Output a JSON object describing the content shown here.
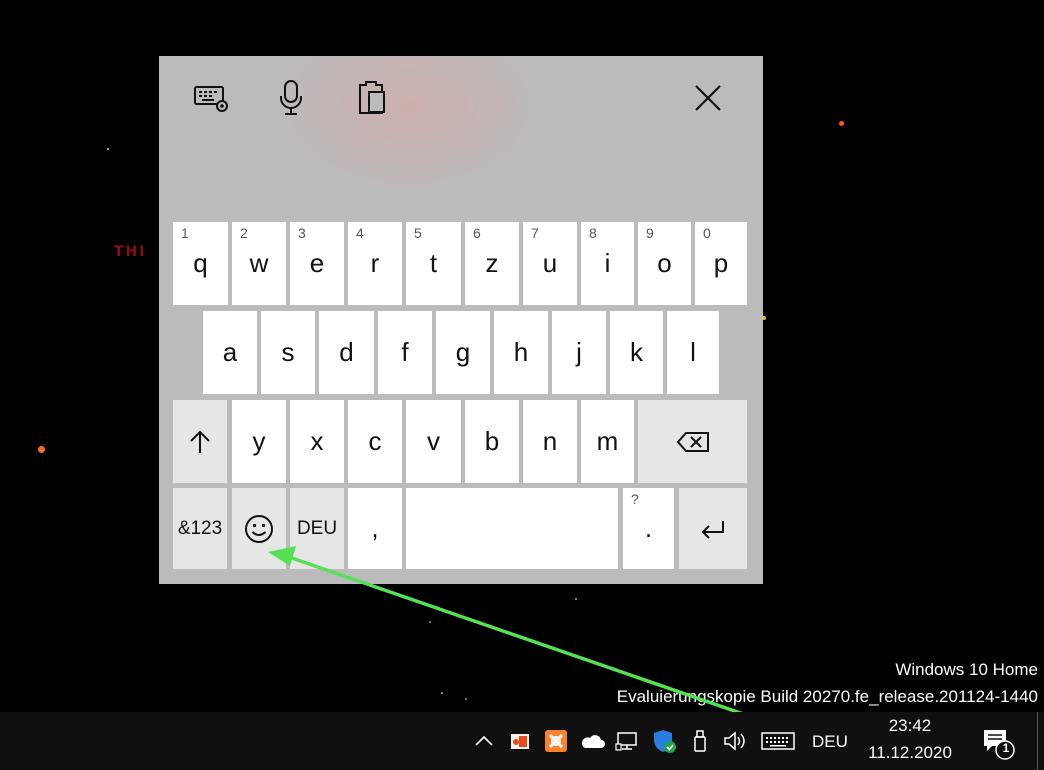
{
  "desktop": {
    "background_text": "THI",
    "watermark_line1": "Windows 10 Home",
    "watermark_line2": "Evaluierungskopie Build 20270.fe_release.201124-1440"
  },
  "keyboard": {
    "toolbar": [
      {
        "name": "keyboard-settings-icon"
      },
      {
        "name": "microphone-icon"
      },
      {
        "name": "clipboard-icon"
      }
    ],
    "close_icon": "close-icon",
    "row1": [
      {
        "num": "1",
        "label": "q"
      },
      {
        "num": "2",
        "label": "w"
      },
      {
        "num": "3",
        "label": "e"
      },
      {
        "num": "4",
        "label": "r"
      },
      {
        "num": "5",
        "label": "t"
      },
      {
        "num": "6",
        "label": "z"
      },
      {
        "num": "7",
        "label": "u"
      },
      {
        "num": "8",
        "label": "i"
      },
      {
        "num": "9",
        "label": "o"
      },
      {
        "num": "0",
        "label": "p"
      }
    ],
    "row2": [
      "a",
      "s",
      "d",
      "f",
      "g",
      "h",
      "j",
      "k",
      "l"
    ],
    "row3": [
      "y",
      "x",
      "c",
      "v",
      "b",
      "n",
      "m"
    ],
    "symbols_label": "&123",
    "language_label": "DEU",
    "comma_label": ",",
    "period_label": ".",
    "period_alt": "?",
    "icons": {
      "shift": "shift-arrow-icon",
      "backspace": "backspace-icon",
      "emoji": "emoji-icon",
      "enter": "enter-icon"
    }
  },
  "annotation": {
    "color": "#55e055"
  },
  "taskbar": {
    "tray_icons": [
      "chevron-up-icon",
      "app-icon-red",
      "xampp-icon",
      "onedrive-icon",
      "network-icon",
      "windows-security-icon",
      "usb-drive-icon",
      "volume-icon",
      "touch-keyboard-icon"
    ],
    "language": "DEU",
    "time": "23:42",
    "date": "11.12.2020",
    "notifications_count": "1"
  }
}
